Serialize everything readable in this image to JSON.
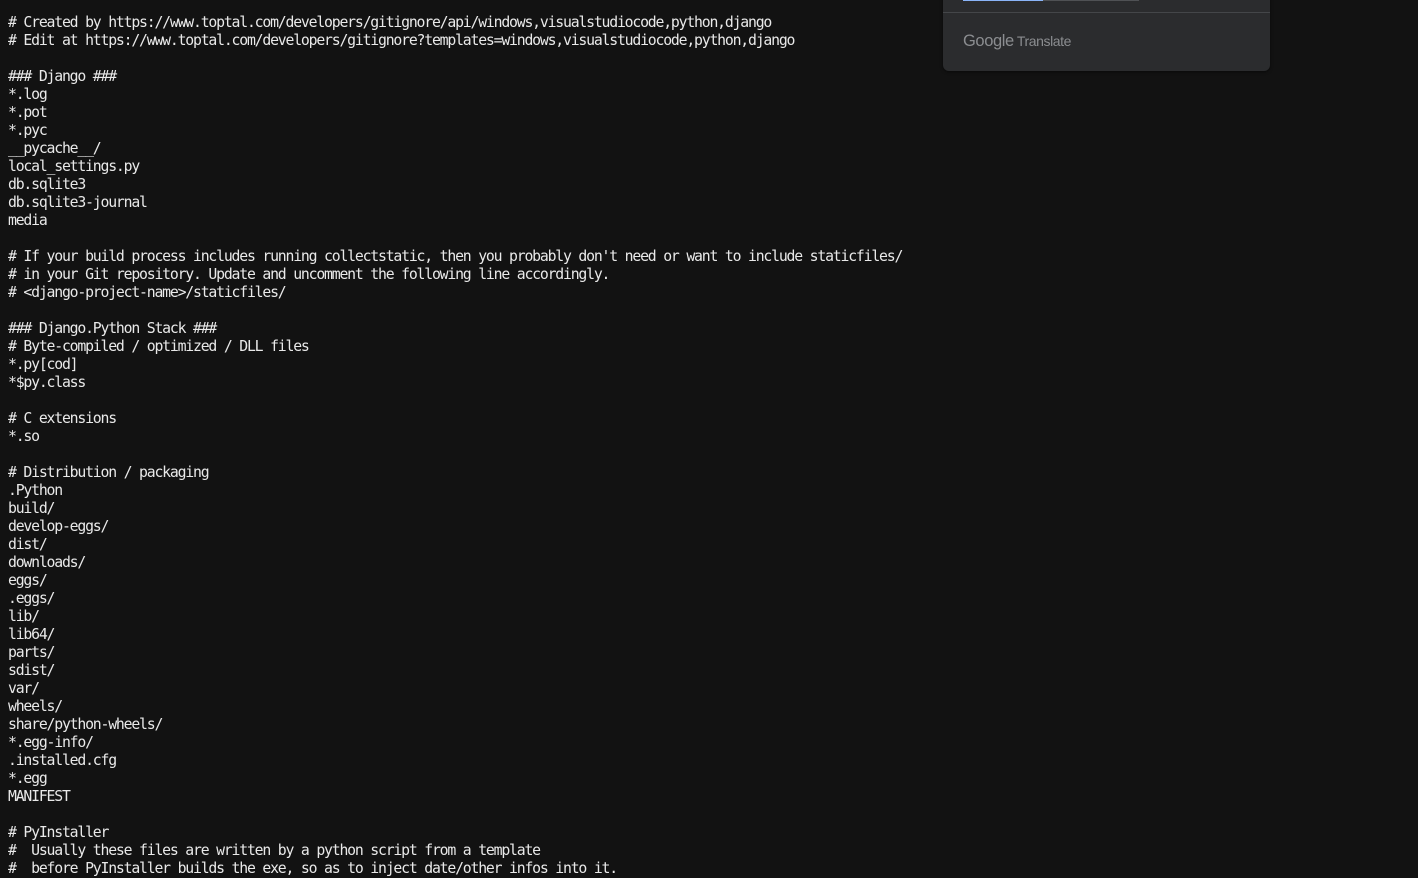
{
  "document": {
    "content": "# Created by https://www.toptal.com/developers/gitignore/api/windows,visualstudiocode,python,django\n# Edit at https://www.toptal.com/developers/gitignore?templates=windows,visualstudiocode,python,django\n\n### Django ###\n*.log\n*.pot\n*.pyc\n__pycache__/\nlocal_settings.py\ndb.sqlite3\ndb.sqlite3-journal\nmedia\n\n# If your build process includes running collectstatic, then you probably don't need or want to include staticfiles/\n# in your Git repository. Update and uncomment the following line accordingly.\n# <django-project-name>/staticfiles/\n\n### Django.Python Stack ###\n# Byte-compiled / optimized / DLL files\n*.py[cod]\n*$py.class\n\n# C extensions\n*.so\n\n# Distribution / packaging\n.Python\nbuild/\ndevelop-eggs/\ndist/\ndownloads/\neggs/\n.eggs/\nlib/\nlib64/\nparts/\nsdist/\nvar/\nwheels/\nshare/python-wheels/\n*.egg-info/\n.installed.cfg\n*.egg\nMANIFEST\n\n# PyInstaller\n#  Usually these files are written by a python script from a template\n#  before PyInstaller builds the exe, so as to inject date/other infos into it."
  },
  "translate_popup": {
    "logo_text": "Google",
    "product_text": "Translate"
  },
  "colors": {
    "background": "#121212",
    "text": "#e9e9e9",
    "popup_background": "#2b2c2e",
    "popup_accent": "#8ab4f8"
  }
}
